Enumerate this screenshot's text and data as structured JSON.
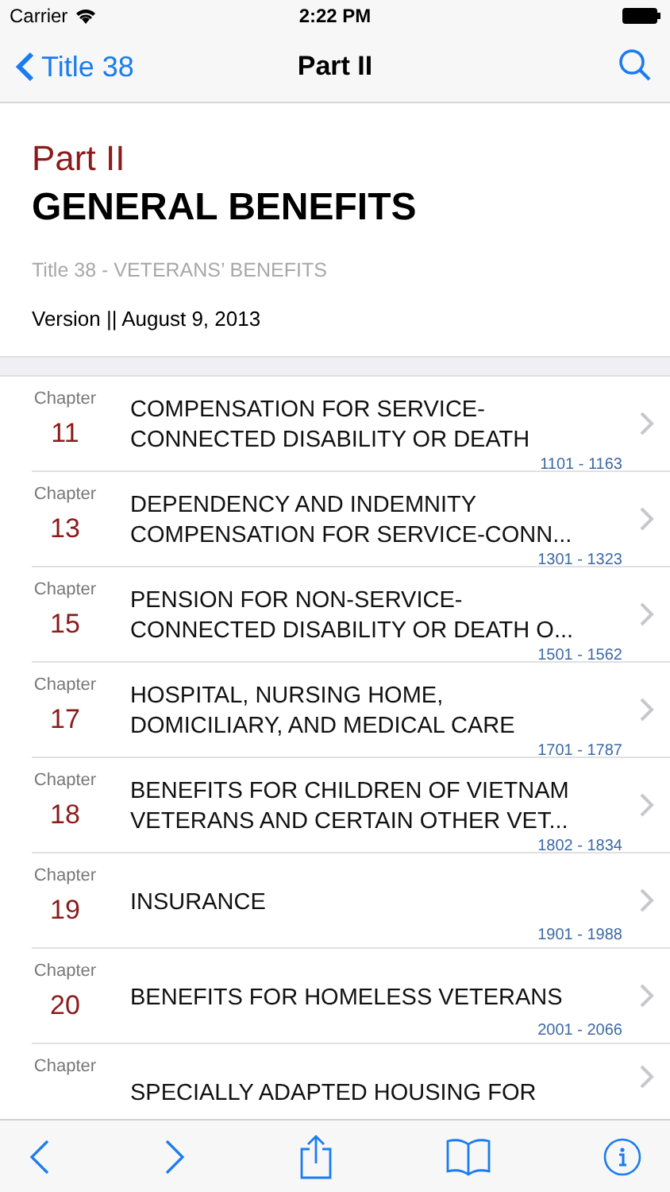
{
  "status_bar": {
    "carrier": "Carrier",
    "time": "2:22 PM"
  },
  "nav_bar": {
    "back": "Title 38",
    "title": "Part II"
  },
  "header": {
    "part": "Part II",
    "heading": "GENERAL BENEFITS",
    "subtitle": "Title 38 - VETERANS’ BENEFITS",
    "version": "Version || August 9, 2013"
  },
  "chapters": [
    {
      "label": "Chapter",
      "number": "11",
      "title": "COMPENSATION FOR SERVICE-\nCONNECTED DISABILITY OR DEATH",
      "range": "1101 - 1163"
    },
    {
      "label": "Chapter",
      "number": "13",
      "title": "DEPENDENCY AND INDEMNITY\nCOMPENSATION FOR SERVICE-CONN...",
      "range": "1301 - 1323"
    },
    {
      "label": "Chapter",
      "number": "15",
      "title": "PENSION FOR NON-SERVICE-\nCONNECTED DISABILITY OR DEATH O...",
      "range": "1501 - 1562"
    },
    {
      "label": "Chapter",
      "number": "17",
      "title": "HOSPITAL, NURSING HOME,\nDOMICILIARY, AND MEDICAL CARE",
      "range": "1701 - 1787"
    },
    {
      "label": "Chapter",
      "number": "18",
      "title": "BENEFITS FOR CHILDREN OF VIETNAM\nVETERANS AND CERTAIN OTHER VET...",
      "range": "1802 - 1834"
    },
    {
      "label": "Chapter",
      "number": "19",
      "title": "INSURANCE",
      "range": "1901 - 1988"
    },
    {
      "label": "Chapter",
      "number": "20",
      "title": "BENEFITS FOR HOMELESS VETERANS",
      "range": "2001 - 2066"
    },
    {
      "label": "Chapter",
      "title": "SPECIALLY ADAPTED HOUSING FOR"
    }
  ]
}
